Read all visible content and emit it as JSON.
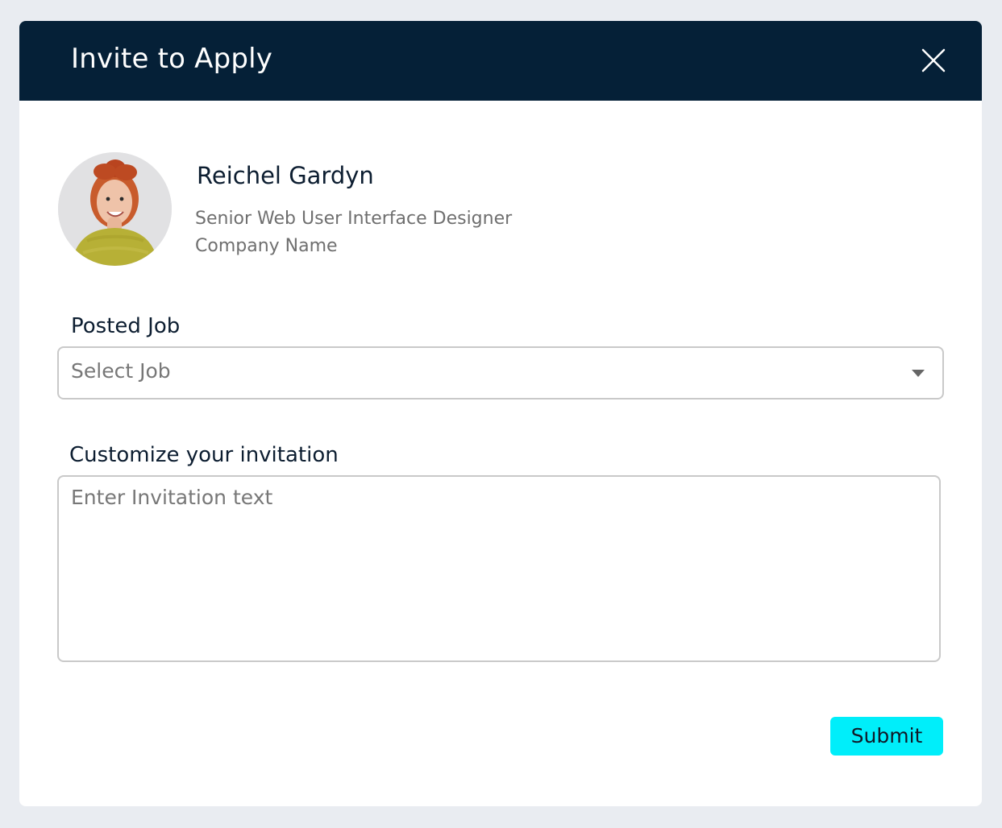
{
  "modal": {
    "title": "Invite to Apply",
    "close_icon": "close-icon",
    "header_color": "#052037"
  },
  "candidate": {
    "name": "Reichel Gardyn",
    "title": "Senior Web User Interface Designer",
    "company": "Company Name",
    "avatar_icon": "avatar-photo"
  },
  "posted_job": {
    "label": "Posted Job",
    "selected_value": "Select Job",
    "arrow_icon": "dropdown-arrow-icon"
  },
  "invitation": {
    "label": "Customize your invitation",
    "value": "",
    "placeholder": "Enter Invitation text"
  },
  "actions": {
    "submit_label": "Submit",
    "submit_color": "#00eefa"
  }
}
